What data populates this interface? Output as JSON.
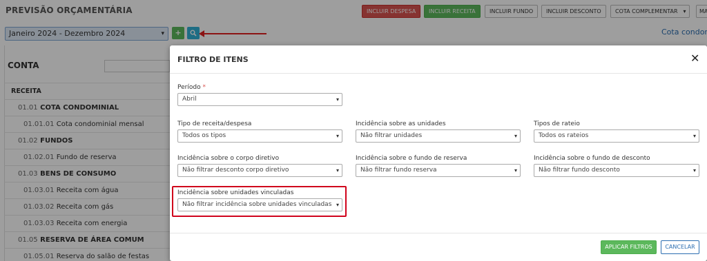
{
  "page": {
    "title": "PREVISÃO ORÇAMENTÁRIA",
    "buttons": {
      "incluir_despesa": "INCLUIR DESPESA",
      "incluir_receita": "INCLUIR RECEITA",
      "incluir_fundo": "INCLUIR FUNDO",
      "incluir_desconto": "INCLUIR DESCONTO",
      "cota_complementar": "COTA COMPLEMENTAR",
      "more": "MA"
    },
    "period_select": "Janeiro 2024 - Dezembro 2024",
    "right_link": "Cota condom",
    "conta_label": "CONTA",
    "tree": [
      {
        "code": "",
        "label": "RECEITA"
      },
      {
        "code": "01.01",
        "label": "COTA CONDOMINIAL"
      },
      {
        "code": "01.01.01",
        "label": "Cota condominial mensal"
      },
      {
        "code": "01.02",
        "label": "FUNDOS"
      },
      {
        "code": "01.02.01",
        "label": "Fundo de reserva"
      },
      {
        "code": "01.03",
        "label": "BENS DE CONSUMO"
      },
      {
        "code": "01.03.01",
        "label": "Receita com água"
      },
      {
        "code": "01.03.02",
        "label": "Receita com gás"
      },
      {
        "code": "01.03.03",
        "label": "Receita com energia"
      },
      {
        "code": "01.05",
        "label": "RESERVA DE ÁREA COMUM"
      },
      {
        "code": "01.05.01",
        "label": "Reserva do salão de festas"
      }
    ]
  },
  "modal": {
    "title": "FILTRO DE ITENS",
    "fields": {
      "periodo": {
        "label": "Período",
        "required_mark": "*",
        "value": "Abril"
      },
      "tipo": {
        "label": "Tipo de receita/despesa",
        "value": "Todos os tipos"
      },
      "inc_unidades": {
        "label": "Incidência sobre as unidades",
        "value": "Não filtrar unidades"
      },
      "tipos_rateio": {
        "label": "Tipos de rateio",
        "value": "Todos os rateios"
      },
      "inc_corpo": {
        "label": "Incidência sobre o corpo diretivo",
        "value": "Não filtrar desconto corpo diretivo"
      },
      "inc_fundo_reserva": {
        "label": "Incidência sobre o fundo de reserva",
        "value": "Não filtrar fundo reserva"
      },
      "inc_fundo_desconto": {
        "label": "Incidência sobre o fundo de desconto",
        "value": "Não filtrar fundo desconto"
      },
      "inc_vinculadas": {
        "label": "Incidência sobre unidades vinculadas",
        "value": "Não filtrar incidência sobre unidades vinculadas"
      }
    },
    "apply_label": "APLICAR FILTROS",
    "cancel_label": "CANCELAR"
  },
  "colors": {
    "accent_red": "#d9534f",
    "accent_green": "#5cb85c",
    "link_blue": "#2a6db0",
    "highlight": "#d0021b"
  }
}
